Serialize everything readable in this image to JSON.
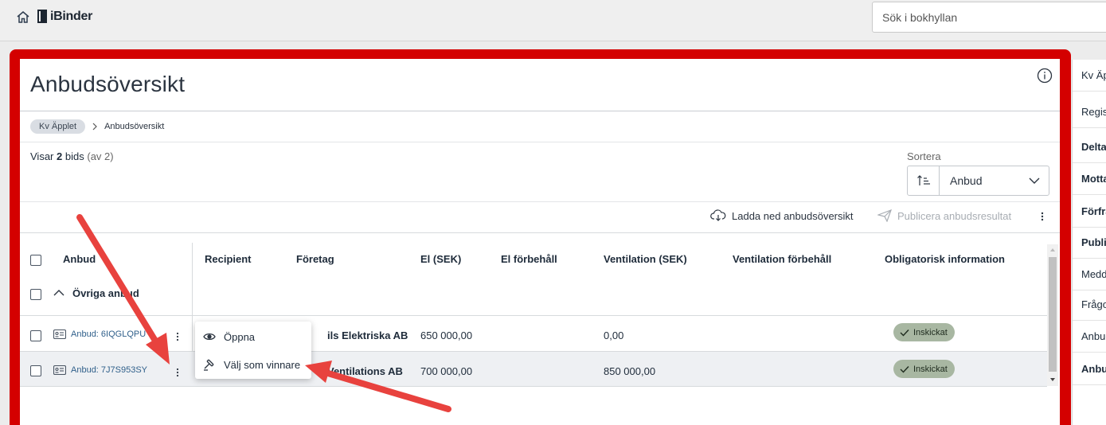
{
  "app": {
    "name": "iBinder"
  },
  "search": {
    "placeholder": "Sök i bokhyllan"
  },
  "page": {
    "title": "Anbudsöversikt"
  },
  "breadcrumb": {
    "parent": "Kv Äpplet",
    "current": "Anbudsöversikt"
  },
  "summary": {
    "prefix": "Visar",
    "count": "2",
    "unit": "bids",
    "total": "(av 2)"
  },
  "sort": {
    "label": "Sortera",
    "value": "Anbud"
  },
  "toolbar": {
    "download_label": "Ladda ned anbudsöversikt",
    "publish_label": "Publicera anbudsresultat"
  },
  "table": {
    "headers": {
      "bid": "Anbud",
      "recipient": "Recipient",
      "company": "Företag",
      "el": "El (SEK)",
      "el_reservation": "El förbehåll",
      "ventilation": "Ventilation (SEK)",
      "ventilation_reservation": "Ventilation förbehåll",
      "mandatory_info": "Obligatorisk information"
    },
    "group_label": "Övriga anbud",
    "rows": [
      {
        "bid": "Anbud: 6IQGLQPU",
        "company": "ils Elektriska AB",
        "el": "650 000,00",
        "ventilation": "0,00",
        "status": "Inskickat"
      },
      {
        "bid": "Anbud: 7J7S953SY",
        "company": "Ventilations AB",
        "el": "700 000,00",
        "ventilation": "850 000,00",
        "status": "Inskickat"
      }
    ]
  },
  "context_menu": {
    "items": [
      "Öppna",
      "Välj som vinnare"
    ]
  },
  "side_panel": {
    "items": [
      {
        "label": "Kv Äpplet",
        "bold": false
      },
      {
        "label": "Registrering",
        "bold": false
      },
      {
        "label": "Deltagare",
        "bold": true
      },
      {
        "label": "Mottagare",
        "bold": true
      },
      {
        "label": "Förfrågan",
        "bold": true
      },
      {
        "label": "Publicering",
        "bold": true
      },
      {
        "label": "Meddelanden",
        "bold": false
      },
      {
        "label": "Frågor",
        "bold": false
      },
      {
        "label": "Anbud",
        "bold": false
      },
      {
        "label": "Anbudsöversikt",
        "bold": true
      }
    ]
  },
  "colors": {
    "frame_red": "#d40000",
    "badge_green": "#a8b7a2",
    "arrow_red": "#e8423e",
    "link_blue": "#2f5f8a"
  }
}
